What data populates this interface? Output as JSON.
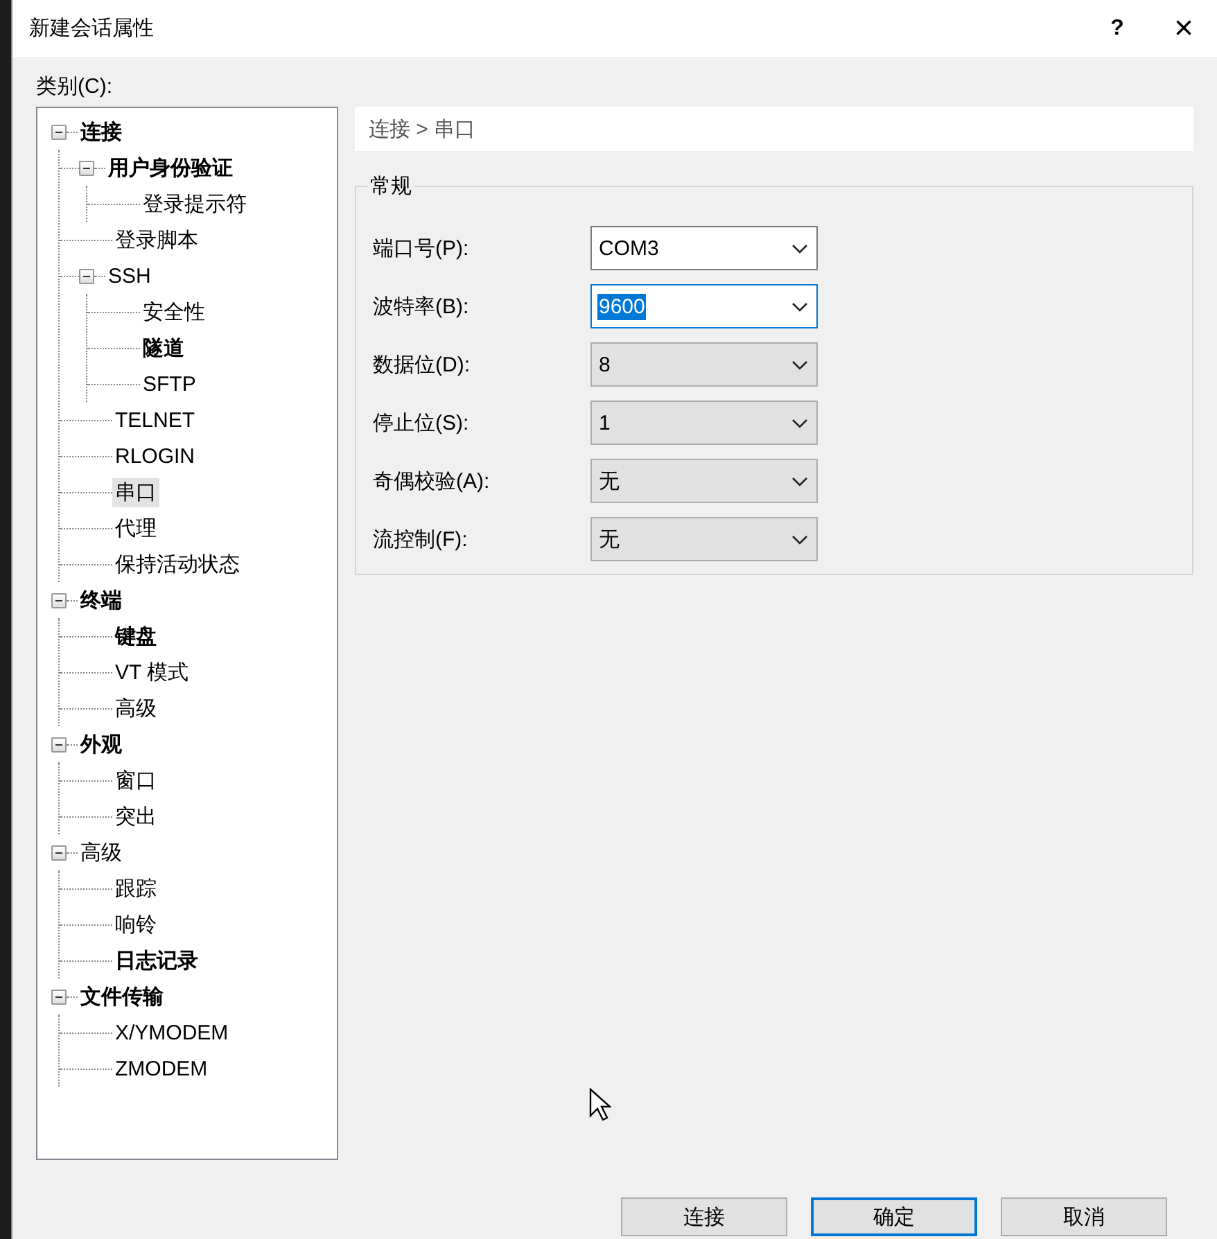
{
  "window": {
    "title": "新建会话属性",
    "help": "?",
    "close": "×"
  },
  "category_label": "类别(C):",
  "tree": [
    {
      "label": "连接",
      "bold": true,
      "selected": false,
      "expanded": true,
      "children": [
        {
          "label": "用户身份验证",
          "bold": true,
          "selected": false,
          "expanded": true,
          "children": [
            {
              "label": "登录提示符",
              "bold": false,
              "selected": false
            }
          ]
        },
        {
          "label": "登录脚本",
          "bold": false,
          "selected": false
        },
        {
          "label": "SSH",
          "bold": false,
          "selected": false,
          "expanded": true,
          "children": [
            {
              "label": "安全性",
              "bold": false,
              "selected": false
            },
            {
              "label": "隧道",
              "bold": true,
              "selected": false
            },
            {
              "label": "SFTP",
              "bold": false,
              "selected": false
            }
          ]
        },
        {
          "label": "TELNET",
          "bold": false,
          "selected": false
        },
        {
          "label": "RLOGIN",
          "bold": false,
          "selected": false
        },
        {
          "label": "串口",
          "bold": false,
          "selected": true
        },
        {
          "label": "代理",
          "bold": false,
          "selected": false
        },
        {
          "label": "保持活动状态",
          "bold": false,
          "selected": false
        }
      ]
    },
    {
      "label": "终端",
      "bold": true,
      "selected": false,
      "expanded": true,
      "children": [
        {
          "label": "键盘",
          "bold": true,
          "selected": false
        },
        {
          "label": "VT 模式",
          "bold": false,
          "selected": false
        },
        {
          "label": "高级",
          "bold": false,
          "selected": false
        }
      ]
    },
    {
      "label": "外观",
      "bold": true,
      "selected": false,
      "expanded": true,
      "children": [
        {
          "label": "窗口",
          "bold": false,
          "selected": false
        },
        {
          "label": "突出",
          "bold": false,
          "selected": false
        }
      ]
    },
    {
      "label": "高级",
      "bold": false,
      "selected": false,
      "expanded": true,
      "children": [
        {
          "label": "跟踪",
          "bold": false,
          "selected": false
        },
        {
          "label": "响铃",
          "bold": false,
          "selected": false
        },
        {
          "label": "日志记录",
          "bold": true,
          "selected": false
        }
      ]
    },
    {
      "label": "文件传输",
      "bold": true,
      "selected": false,
      "expanded": true,
      "children": [
        {
          "label": "X/YMODEM",
          "bold": false,
          "selected": false
        },
        {
          "label": "ZMODEM",
          "bold": false,
          "selected": false
        }
      ]
    }
  ],
  "breadcrumb": "连接 > 串口",
  "group": {
    "title": "常规",
    "fields": [
      {
        "label": "端口号(P):",
        "value": "COM3",
        "editable": true,
        "focused": false
      },
      {
        "label": "波特率(B):",
        "value": "9600",
        "editable": true,
        "focused": true
      },
      {
        "label": "数据位(D):",
        "value": "8",
        "editable": false,
        "focused": false
      },
      {
        "label": "停止位(S):",
        "value": "1",
        "editable": false,
        "focused": false
      },
      {
        "label": "奇偶校验(A):",
        "value": "无",
        "editable": false,
        "focused": false
      },
      {
        "label": "流控制(F):",
        "value": "无",
        "editable": false,
        "focused": false
      }
    ]
  },
  "buttons": [
    {
      "label": "连接",
      "default": false
    },
    {
      "label": "确定",
      "default": true
    },
    {
      "label": "取消",
      "default": false
    }
  ]
}
